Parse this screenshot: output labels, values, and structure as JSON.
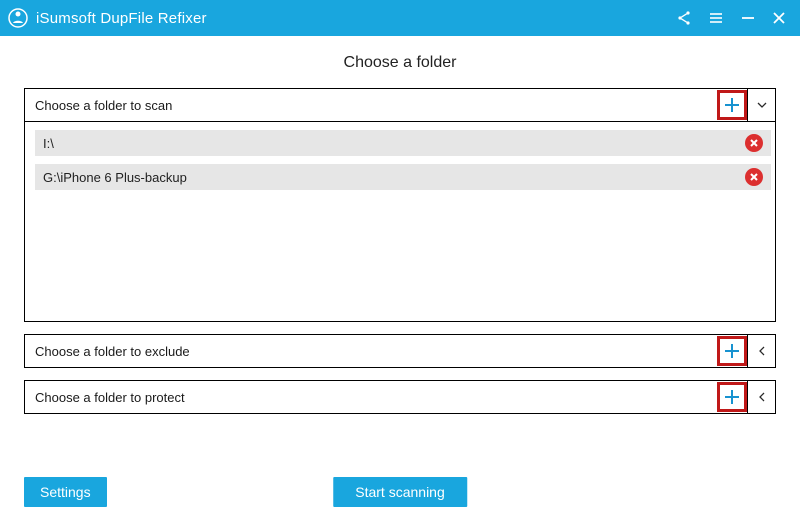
{
  "header": {
    "app_name": "iSumsoft DupFile Refixer"
  },
  "page_title": "Choose a folder",
  "sections": {
    "scan": {
      "label": "Choose a folder to scan",
      "expanded": true
    },
    "exclude": {
      "label": "Choose a folder to exclude",
      "expanded": false
    },
    "protect": {
      "label": "Choose a folder to protect",
      "expanded": false
    }
  },
  "scan_folders": [
    {
      "path": "I:\\"
    },
    {
      "path": "G:\\iPhone 6 Plus-backup"
    }
  ],
  "buttons": {
    "settings": "Settings",
    "start": "Start scanning"
  },
  "colors": {
    "accent": "#19a6de",
    "highlight_box": "#c01818",
    "danger": "#dc2f2f"
  }
}
